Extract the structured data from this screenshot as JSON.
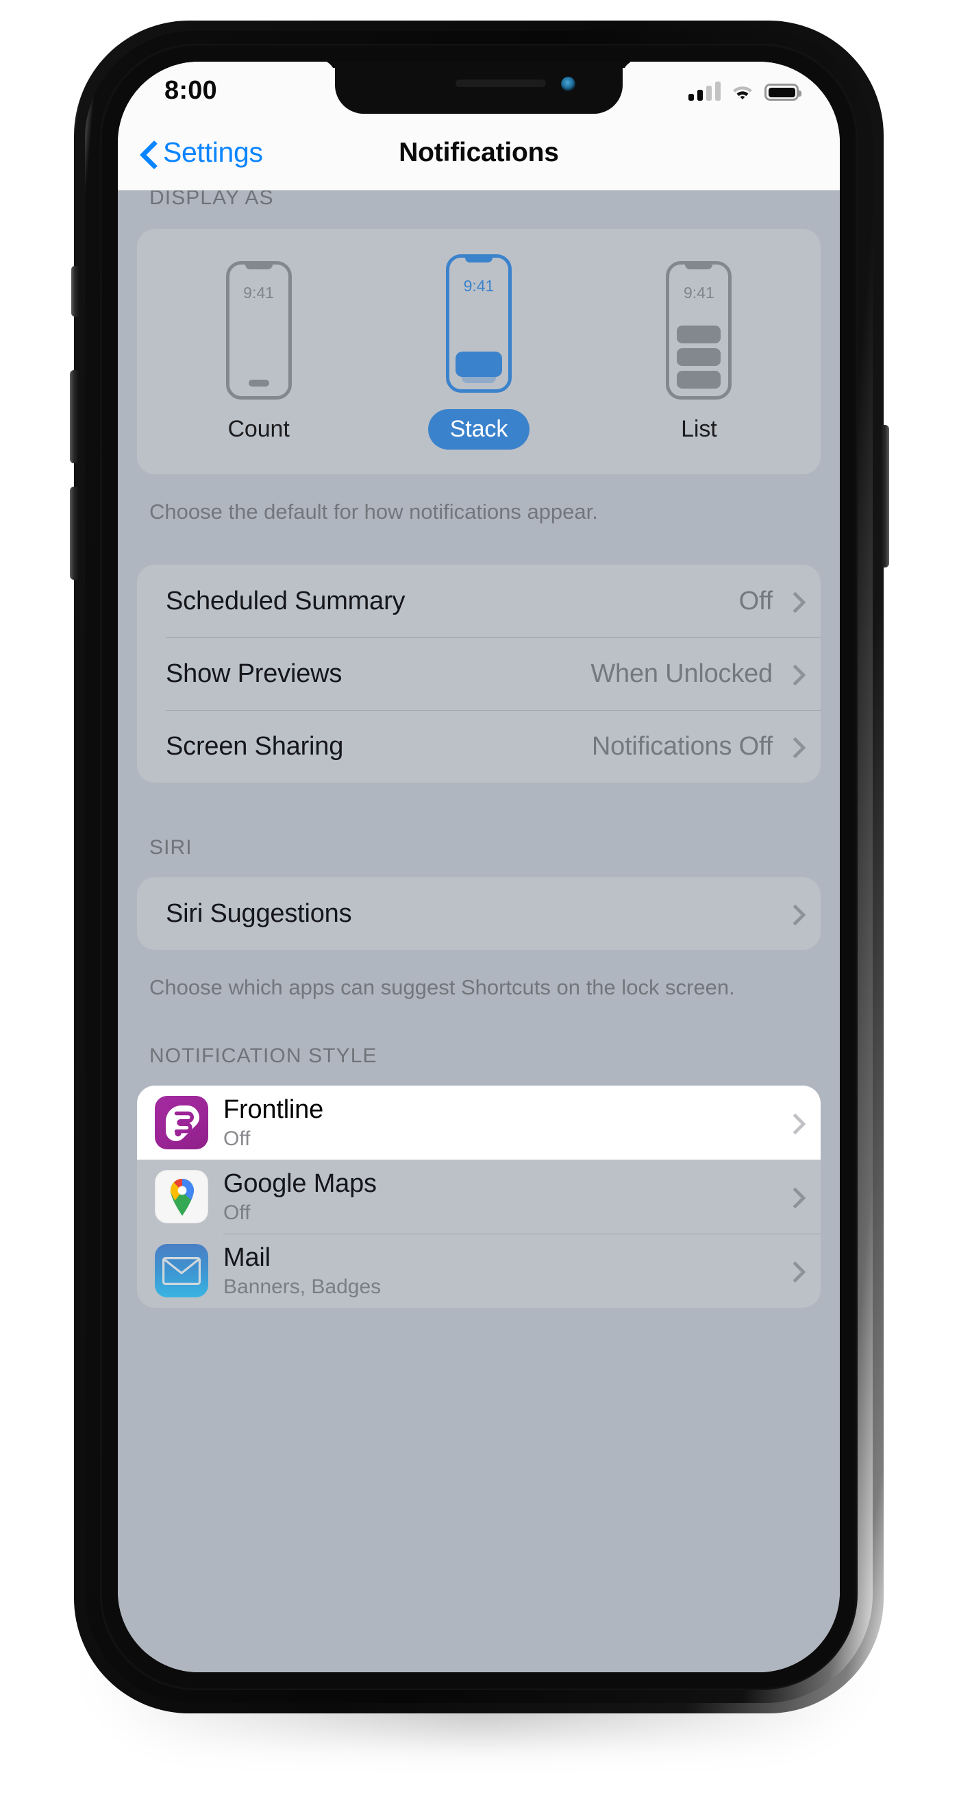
{
  "status_bar": {
    "time": "8:00",
    "cellular_icon": "cellular-signal-icon",
    "cellular_bars_filled": 2,
    "cellular_bars_total": 4,
    "wifi_icon": "wifi-icon",
    "battery_icon": "battery-icon",
    "battery_level_percent": 100
  },
  "nav": {
    "back_label": "Settings",
    "back_icon": "chevron-left-icon",
    "title": "Notifications"
  },
  "display_as": {
    "header": "DISPLAY AS",
    "options": [
      {
        "label": "Count",
        "selected": false,
        "preview_time": "9:41",
        "preview_kind": "count"
      },
      {
        "label": "Stack",
        "selected": true,
        "preview_time": "9:41",
        "preview_kind": "stack"
      },
      {
        "label": "List",
        "selected": false,
        "preview_time": "9:41",
        "preview_kind": "list"
      }
    ],
    "footnote": "Choose the default for how notifications appear."
  },
  "general_rows": [
    {
      "title": "Scheduled Summary",
      "value": "Off",
      "chevron": "chevron-right-icon"
    },
    {
      "title": "Show Previews",
      "value": "When Unlocked",
      "chevron": "chevron-right-icon"
    },
    {
      "title": "Screen Sharing",
      "value": "Notifications Off",
      "chevron": "chevron-right-icon"
    }
  ],
  "siri": {
    "header": "SIRI",
    "row": {
      "title": "Siri Suggestions",
      "value": "",
      "chevron": "chevron-right-icon"
    },
    "footnote": "Choose which apps can suggest Shortcuts on the lock screen."
  },
  "notification_style": {
    "header": "NOTIFICATION STYLE",
    "apps": [
      {
        "name": "Frontline",
        "status": "Off",
        "icon": "frontline-app-icon",
        "highlighted": true
      },
      {
        "name": "Google Maps",
        "status": "Off",
        "icon": "google-maps-app-icon",
        "highlighted": false
      },
      {
        "name": "Mail",
        "status": "Banners, Badges",
        "icon": "mail-app-icon",
        "highlighted": false
      }
    ]
  },
  "colors": {
    "accent_blue": "#0a84ff",
    "selection_blue": "#3b82cc",
    "screen_backdrop": "#b0b6bf",
    "card": "#bcc1c8",
    "frontline_purple": "#9b2496"
  }
}
